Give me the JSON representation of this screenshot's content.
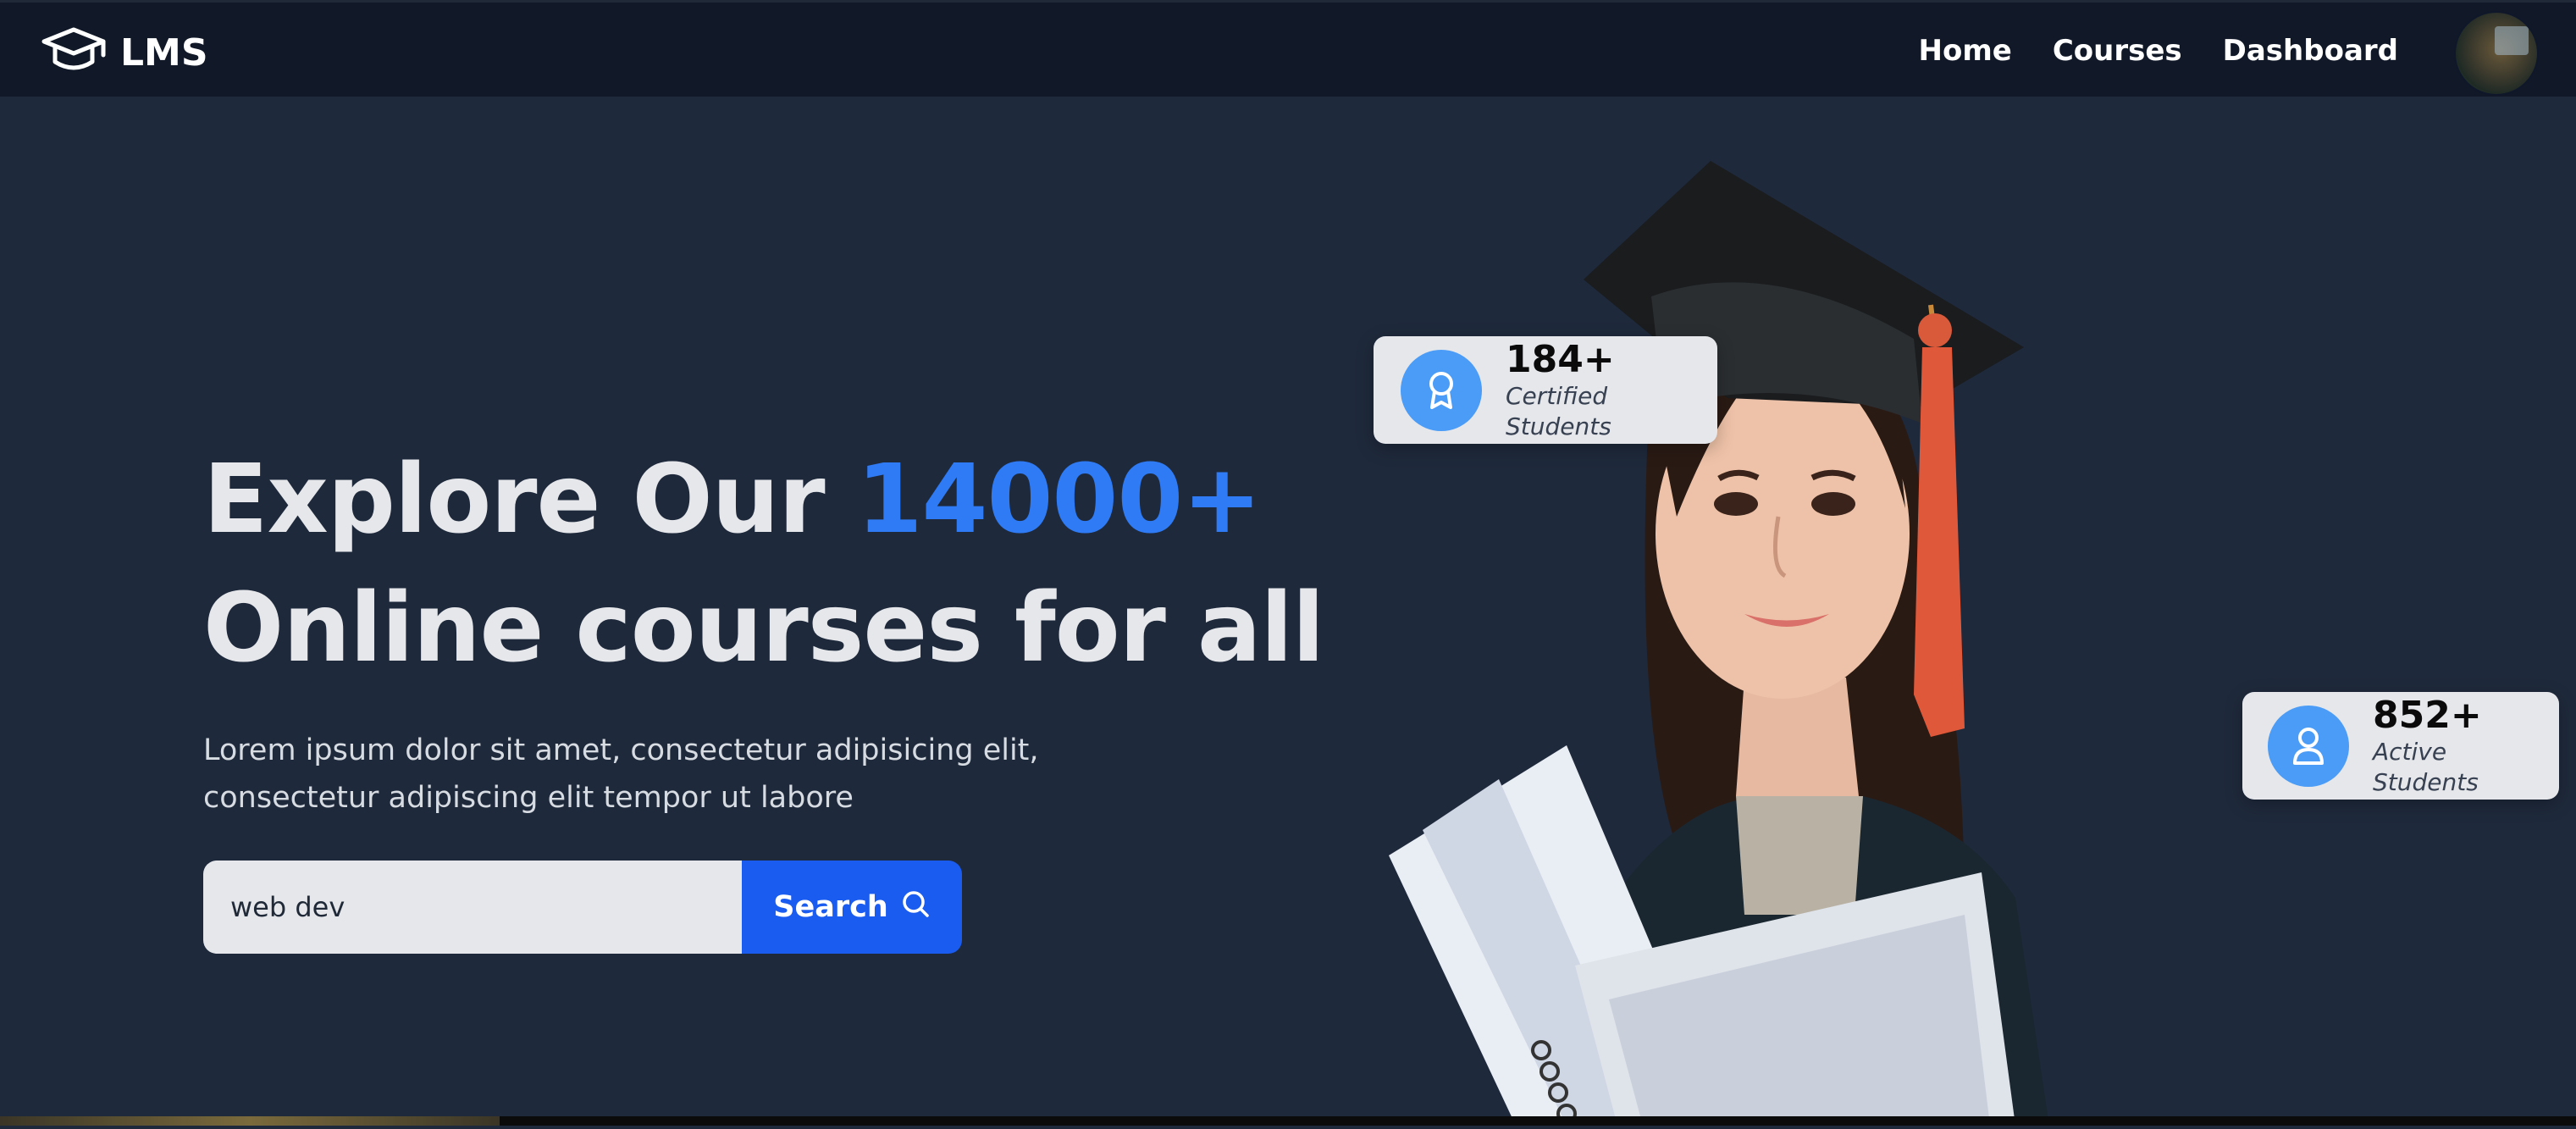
{
  "nav": {
    "brand": "LMS",
    "links": [
      {
        "label": "Home"
      },
      {
        "label": "Courses"
      },
      {
        "label": "Dashboard"
      }
    ]
  },
  "hero": {
    "title_prefix": "Explore Our ",
    "title_highlight": "14000+",
    "title_line2": "Online courses for all",
    "description": "Lorem ipsum dolor sit amet, consectetur adipisicing elit, consectetur adipiscing elit tempor ut labore",
    "search": {
      "value": "web dev",
      "button_label": "Search"
    }
  },
  "stats": [
    {
      "value": "184+",
      "label": "Certified Students",
      "icon": "award-icon"
    },
    {
      "value": "852+",
      "label": "Active Students",
      "icon": "user-icon"
    }
  ],
  "colors": {
    "background": "#1e293b",
    "navbar": "#111827",
    "accent": "#2f7bf5",
    "button": "#1a5cf0",
    "stat_icon_bg": "#4a9cf7"
  }
}
